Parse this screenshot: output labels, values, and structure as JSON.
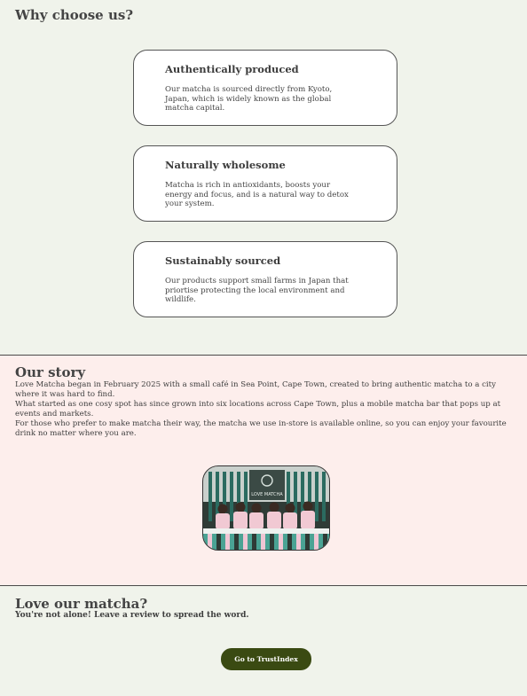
{
  "why": {
    "title": "Why choose us?",
    "cards": [
      {
        "title": "Authentically produced",
        "body": "Our matcha is sourced directly from Kyoto, Japan, which is widely known as the global matcha capital."
      },
      {
        "title": "Naturally wholesome",
        "body": "Matcha is rich in antioxidants, boosts your energy and focus, and is a natural way to detox your system."
      },
      {
        "title": "Sustainably sourced",
        "body": "Our products support small farms in Japan that priortise protecting the local environment and wildlife."
      }
    ]
  },
  "story": {
    "title": "Our story",
    "paragraphs": [
      "Love Matcha began in February 2025 with a small café in Sea Point, Cape Town, created to bring authentic matcha to a city where it was hard to find.",
      "What started as one cosy spot has since grown into six locations across Cape Town, plus a mobile matcha bar that pops up at events and markets.",
      "For those who prefer to make matcha their way, the matcha we use in-store is available online, so you can enjoy your favourite drink no matter where you are."
    ],
    "photo_sign": "LOVE MATCHA"
  },
  "love": {
    "title": "Love our matcha?",
    "subtitle": "You're not alone! Leave a review to spread the word.",
    "button_label": "Go to TrustIndex"
  },
  "colors": {
    "background_green": "#f0f3eb",
    "background_pink": "#fdeeec",
    "button": "#3a4a12"
  }
}
